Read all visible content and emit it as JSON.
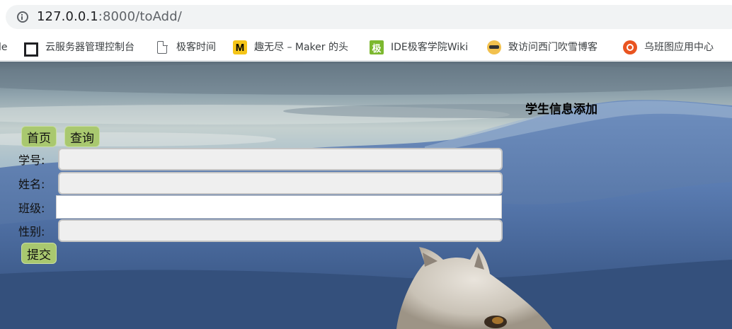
{
  "browser": {
    "url_host": "127.0.0.1",
    "url_rest": ":8000/toAdd/",
    "bookmarks": [
      {
        "label": "le",
        "icon": "none"
      },
      {
        "label": "云服务器管理控制台",
        "icon": "cloud-console-icon"
      },
      {
        "label": "极客时间",
        "icon": "document-icon"
      },
      {
        "label": "趣无尽 – Maker 的头",
        "icon": "maker-m-icon"
      },
      {
        "label": "IDE极客学院Wiki",
        "icon": "jikexueyuan-icon"
      },
      {
        "label": "致访问西门吹雪博客",
        "icon": "blog-icon"
      },
      {
        "label": "乌班图应用中心",
        "icon": "ubuntu-icon"
      }
    ],
    "icon_glyphs": {
      "maker": "M",
      "jike": "极"
    }
  },
  "page": {
    "title": "学生信息添加",
    "nav": {
      "home": "首页",
      "query": "查询"
    },
    "form": {
      "fields": [
        {
          "label": "学号:",
          "value": ""
        },
        {
          "label": "姓名:",
          "value": ""
        },
        {
          "label": "班级:",
          "value": ""
        },
        {
          "label": "性别:",
          "value": ""
        }
      ],
      "submit": "提交"
    },
    "colors": {
      "button_bg": "#a9c86f",
      "field_bg": "#efefef"
    }
  }
}
